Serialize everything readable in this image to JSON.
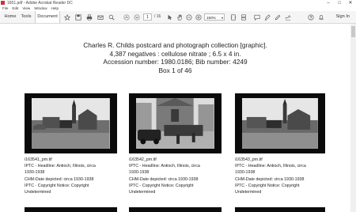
{
  "window": {
    "title": "1651.pdf - Adobe Acrobat Reader DC",
    "min": "–",
    "max": "□",
    "close": "✕"
  },
  "menu": [
    "File",
    "Edit",
    "View",
    "Window",
    "Help"
  ],
  "toolbar": {
    "tabs": [
      "Home",
      "Tools",
      "Document"
    ],
    "page_current": "1",
    "page_total": "/ 16",
    "zoom": "150%",
    "sign_in": "Sign In",
    "icons": [
      "star-icon",
      "save-icon",
      "print-icon",
      "email-icon",
      "find-icon",
      "prev-page-icon",
      "next-page-icon",
      "select-cursor-icon",
      "hand-icon",
      "zoom-out-icon",
      "zoom-in-icon",
      "fit-page-icon",
      "scroll-mode-icon",
      "comment-icon",
      "highlight-icon",
      "pen-icon",
      "sign-icon",
      "help-icon",
      "notification-icon"
    ]
  },
  "document": {
    "heading": [
      "Charles R. Childs postcard and photograph collection [graphic].",
      "4,387 negatives : cellulose nitrate ; 6.5 x 4 in.",
      "Accession number: 1980.0186; Bib number: 4249",
      "Box 1 of 46"
    ],
    "cards": [
      {
        "filename": "i163541_pm.tif",
        "lines": [
          "IPTC - Headline: Antioch, Illinois, circa",
          "1930-1938",
          "CHM-Date depicted: circa 1930-1938",
          "IPTC - Copyright Notice: Copyright",
          "Undetermined"
        ]
      },
      {
        "filename": "i163542_pm.tif",
        "lines": [
          "IPTC - Headline: Antioch, Illinois, circa",
          "1930-1938",
          "CHM-Date depicted: circa 1930-1938",
          "IPTC - Copyright Notice: Copyright",
          "Undetermined"
        ]
      },
      {
        "filename": "i163543_pm.tif",
        "lines": [
          "IPTC - Headline: Antioch, Illinois, circa",
          "1930-1938",
          "CHM-Date depicted: circa 1930-1938",
          "IPTC - Copyright Notice: Copyright",
          "Undetermined"
        ]
      }
    ]
  }
}
